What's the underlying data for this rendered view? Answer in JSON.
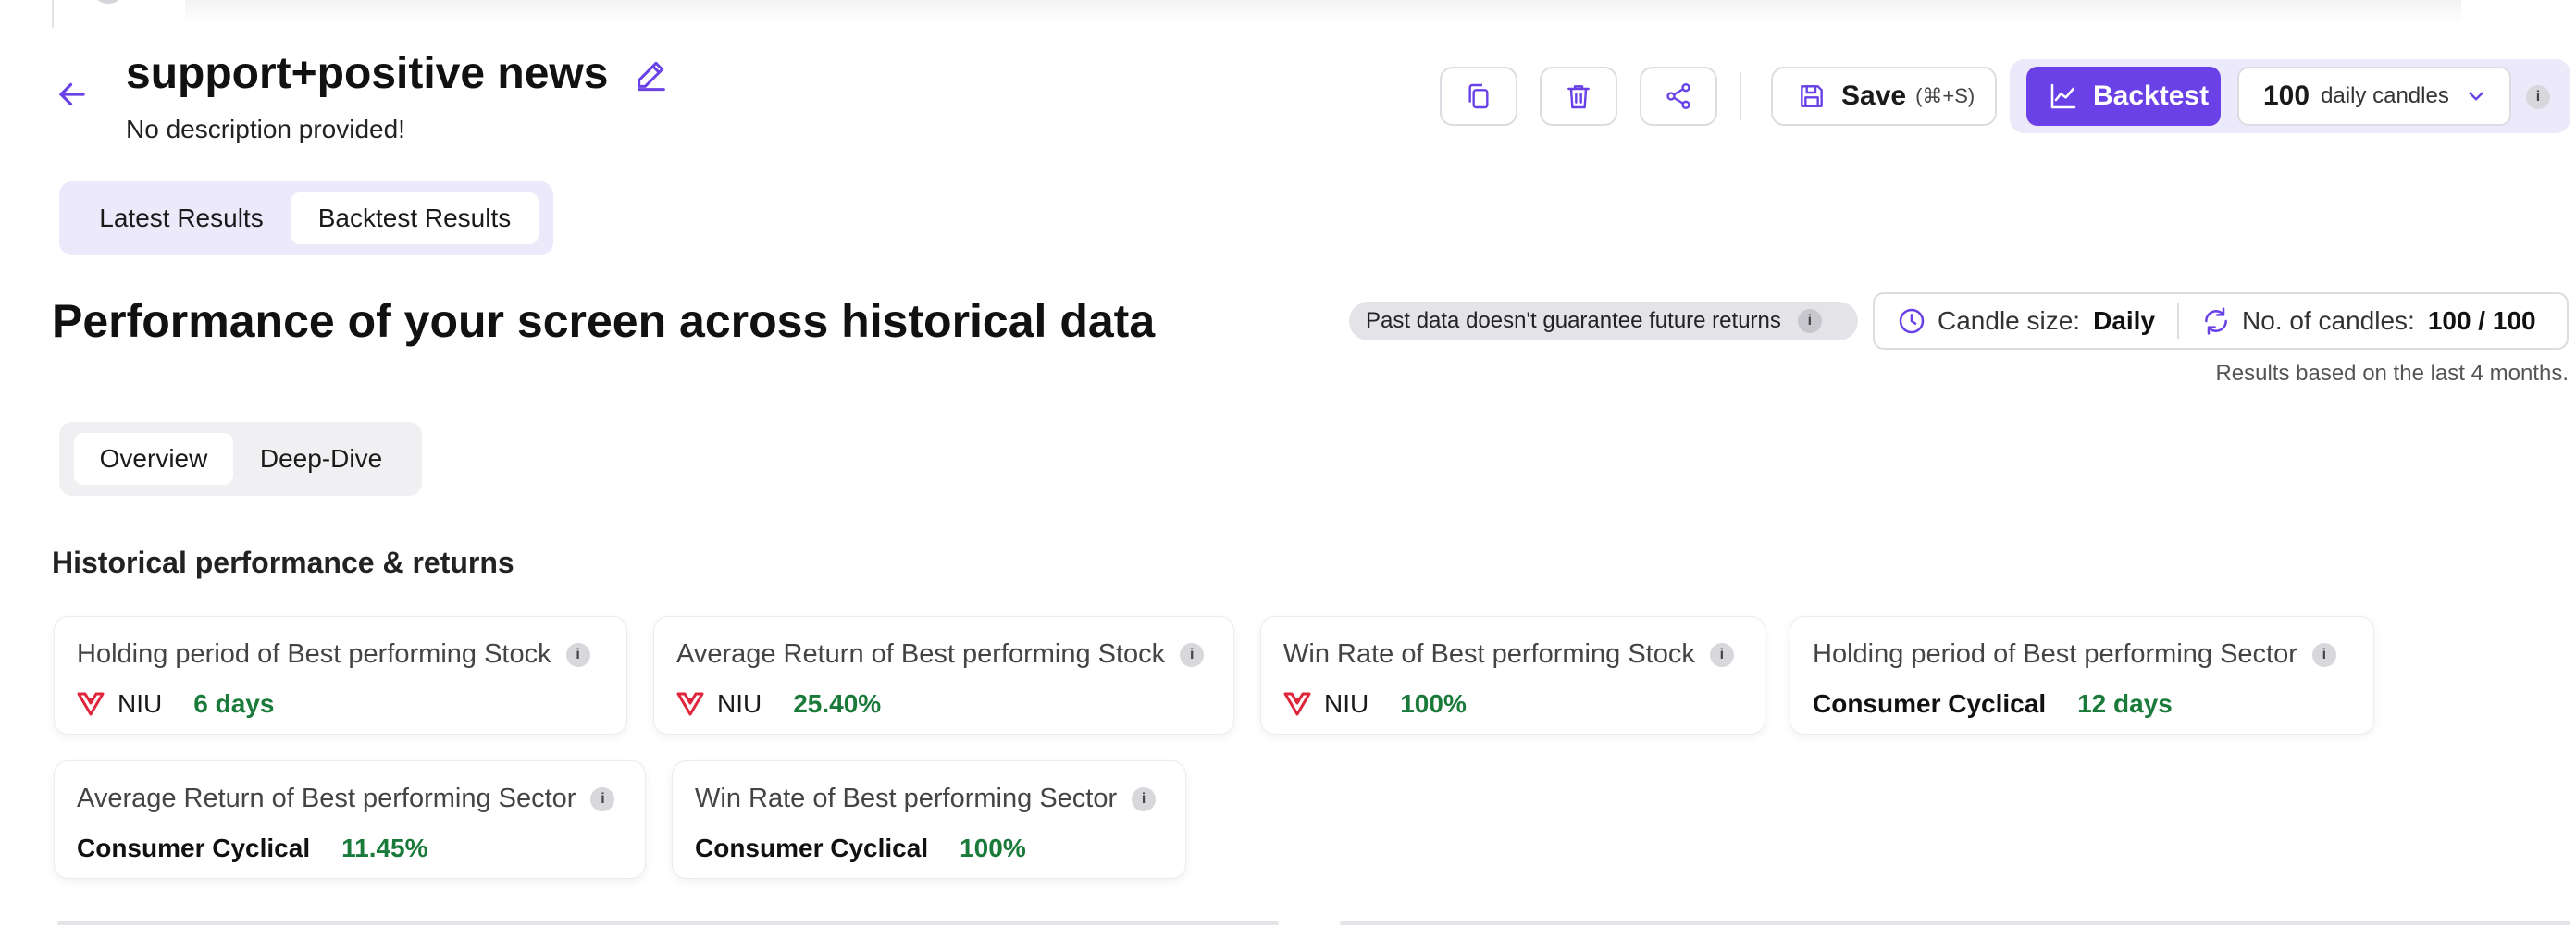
{
  "header": {
    "title": "support+positive news",
    "description": "No description provided!"
  },
  "toolbar": {
    "save_label": "Save",
    "save_shortcut": "(⌘+S)",
    "backtest_label": "Backtest",
    "candles_count": "100",
    "candles_text": "daily candles",
    "info": "i",
    "icons": [
      "copy-icon",
      "trash-icon",
      "share-icon",
      "save-icon",
      "chart-line-icon",
      "chevron-down-icon"
    ]
  },
  "main_tabs": [
    {
      "label": "Latest Results",
      "active": false
    },
    {
      "label": "Backtest Results",
      "active": true
    }
  ],
  "performance": {
    "title": "Performance of your screen across historical data",
    "disclaimer": "Past data doesn't guarantee future returns",
    "candle_size_label": "Candle size:",
    "candle_size_value": "Daily",
    "candles_label": "No. of candles:",
    "candles_value": "100 / 100",
    "results_note": "Results based on the last 4 months."
  },
  "sub_tabs": [
    {
      "label": "Overview",
      "active": true
    },
    {
      "label": "Deep-Dive",
      "active": false
    }
  ],
  "section": {
    "title": "Historical performance & returns"
  },
  "cards": [
    {
      "label": "Holding period of Best performing Stock",
      "ticker": "NIU",
      "value": "6 days"
    },
    {
      "label": "Average Return of Best performing Stock",
      "ticker": "NIU",
      "value": "25.40%"
    },
    {
      "label": "Win Rate of Best performing Stock",
      "ticker": "NIU",
      "value": "100%"
    },
    {
      "label": "Holding period of Best performing Sector",
      "sector": "Consumer Cyclical",
      "value": "12 days"
    },
    {
      "label": "Average Return of Best performing Sector",
      "sector": "Consumer Cyclical",
      "value": "11.45%"
    },
    {
      "label": "Win Rate of Best performing Sector",
      "sector": "Consumer Cyclical",
      "value": "100%"
    }
  ],
  "colors": {
    "accent": "#6941e6",
    "accent_light": "#ece9fb",
    "positive": "#1a7a3a",
    "logo_red": "#e0263a"
  }
}
